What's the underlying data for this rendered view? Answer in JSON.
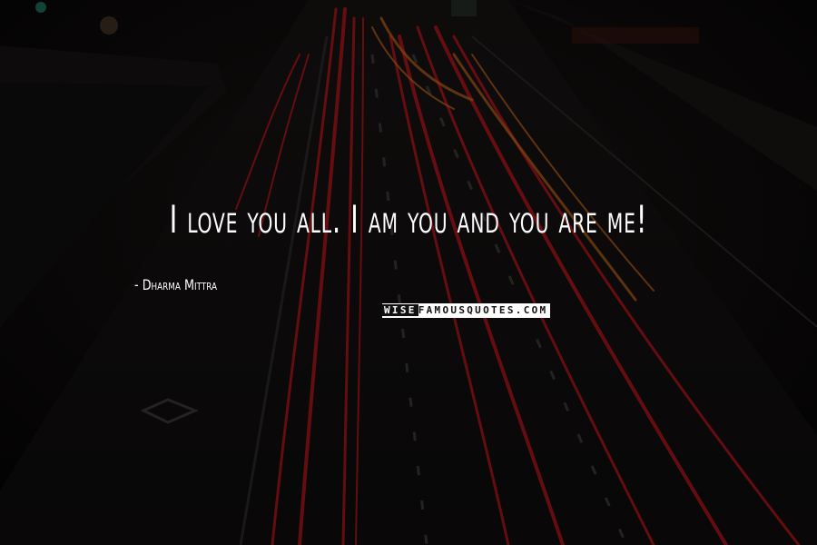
{
  "quote": {
    "text": "I love you all. I am you and you are me!",
    "author": "- Dharma Mittra"
  },
  "watermark": {
    "lead": "WISE",
    "rest": "FAMOUSQUOTES.COM"
  },
  "colors": {
    "background": "#0c0a0a",
    "light_trail": "#b3161c",
    "amber_trail": "#c96a1a",
    "text": "#ffffff"
  }
}
